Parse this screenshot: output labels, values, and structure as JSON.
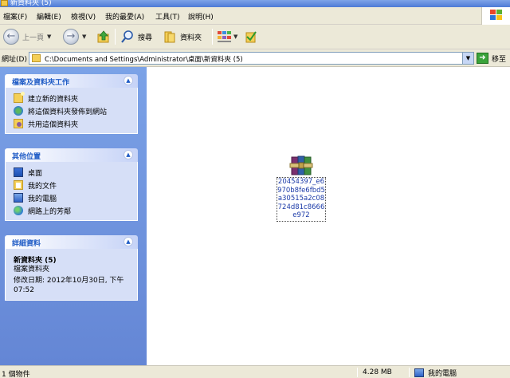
{
  "window": {
    "title": "新資料夾 (5)"
  },
  "menu": {
    "items": [
      "檔案(F)",
      "編輯(E)",
      "檢視(V)",
      "我的最愛(A)",
      "工具(T)",
      "說明(H)"
    ]
  },
  "toolbar": {
    "back_label": "上一頁",
    "search_label": "搜尋",
    "folders_label": "資料夾"
  },
  "address": {
    "label": "網址(D)",
    "path": "C:\\Documents and Settings\\Administrator\\桌面\\新資料夾 (5)",
    "go_label": "移至"
  },
  "tasks_panel": {
    "title": "檔案及資料夾工作",
    "items": [
      "建立新的資料夾",
      "將這個資料夾發佈到網站",
      "共用這個資料夾"
    ]
  },
  "places_panel": {
    "title": "其他位置",
    "items": [
      "桌面",
      "我的文件",
      "我的電腦",
      "網路上的芳鄰"
    ]
  },
  "details_panel": {
    "title": "詳細資料",
    "name": "新資料夾 (5)",
    "type": "檔案資料夾",
    "modified_line1": "修改日期: 2012年10月30日, 下午",
    "modified_line2": "07:52"
  },
  "files": [
    {
      "name": "20454397_e6970b8fe6fbd5a30515a2c08724d81c8666e972",
      "icon": "winrar-archive-icon"
    }
  ],
  "status": {
    "count": "1 個物件",
    "size": "4.28 MB",
    "zone": "我的電腦"
  },
  "colors": {
    "left_pane_top": "#7ba2e7",
    "left_pane_bottom": "#6486d5",
    "panel_title": "#215dc6",
    "chrome": "#ece9d8"
  }
}
